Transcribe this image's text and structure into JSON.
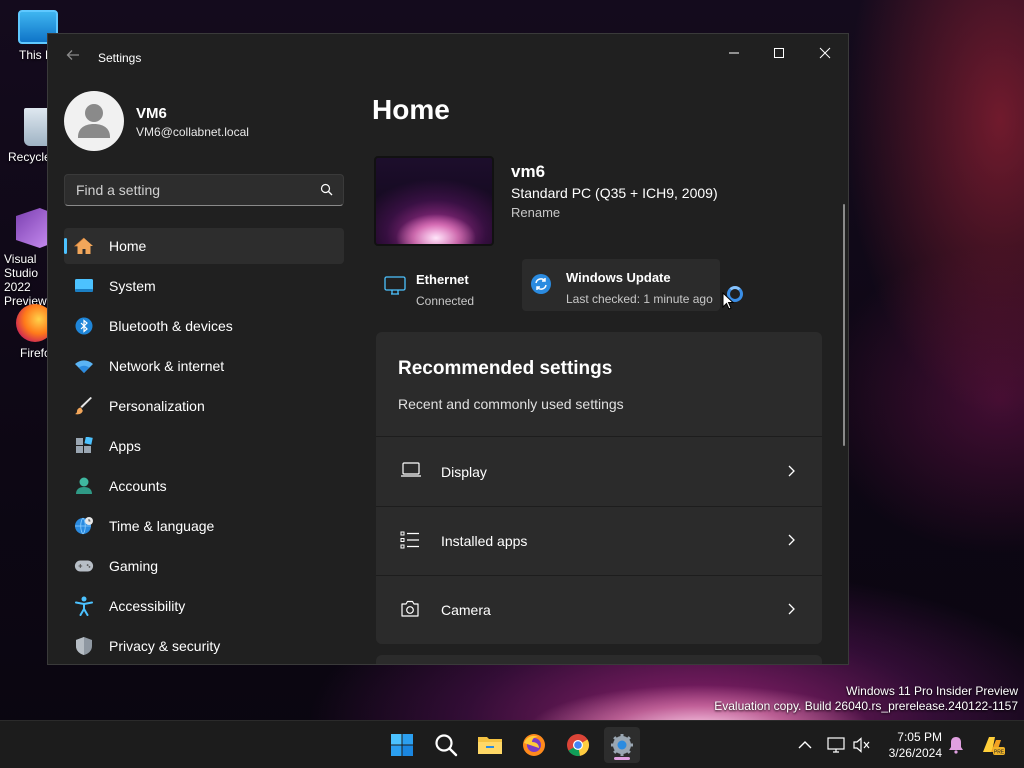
{
  "desktop": {
    "icons": [
      {
        "name": "this-pc",
        "label": "This PC"
      },
      {
        "name": "recycle-bin",
        "label": "Recycle Bin"
      },
      {
        "name": "visual-studio",
        "label": "Visual Studio 2022 Preview"
      },
      {
        "name": "firefox",
        "label": "Firefox"
      }
    ],
    "watermark": {
      "line1": "Windows 11 Pro Insider Preview",
      "line2": "Evaluation copy. Build 26040.rs_prerelease.240122-1157"
    }
  },
  "window": {
    "title": "Settings",
    "user": {
      "name": "VM6",
      "email": "VM6@collabnet.local"
    },
    "search": {
      "placeholder": "Find a setting"
    },
    "nav": [
      {
        "label": "Home",
        "icon": "home-icon",
        "active": true
      },
      {
        "label": "System",
        "icon": "system-icon"
      },
      {
        "label": "Bluetooth & devices",
        "icon": "bluetooth-icon"
      },
      {
        "label": "Network & internet",
        "icon": "wifi-icon"
      },
      {
        "label": "Personalization",
        "icon": "brush-icon"
      },
      {
        "label": "Apps",
        "icon": "apps-icon"
      },
      {
        "label": "Accounts",
        "icon": "person-icon"
      },
      {
        "label": "Time & language",
        "icon": "globe-clock-icon"
      },
      {
        "label": "Gaming",
        "icon": "gamepad-icon"
      },
      {
        "label": "Accessibility",
        "icon": "accessibility-icon"
      },
      {
        "label": "Privacy & security",
        "icon": "shield-icon"
      }
    ],
    "main": {
      "title": "Home",
      "pc": {
        "name": "vm6",
        "model": "Standard PC (Q35 + ICH9, 2009)",
        "rename": "Rename"
      },
      "ethernet": {
        "title": "Ethernet",
        "status": "Connected"
      },
      "update": {
        "title": "Windows Update",
        "status": "Last checked: 1 minute ago"
      },
      "recommended": {
        "title": "Recommended settings",
        "subtitle": "Recent and commonly used settings",
        "items": [
          {
            "label": "Display",
            "icon": "display-icon"
          },
          {
            "label": "Installed apps",
            "icon": "list-icon"
          },
          {
            "label": "Camera",
            "icon": "camera-icon"
          }
        ]
      }
    }
  },
  "taskbar": {
    "apps": [
      "start-icon",
      "search-icon",
      "file-explorer-icon",
      "firefox-icon",
      "chrome-icon",
      "settings-icon"
    ],
    "clock": {
      "time": "7:05 PM",
      "date": "3/26/2024"
    }
  },
  "colors": {
    "accent": "#4cc2ff",
    "window_bg": "#202020",
    "card_bg": "#2b2b2b"
  }
}
